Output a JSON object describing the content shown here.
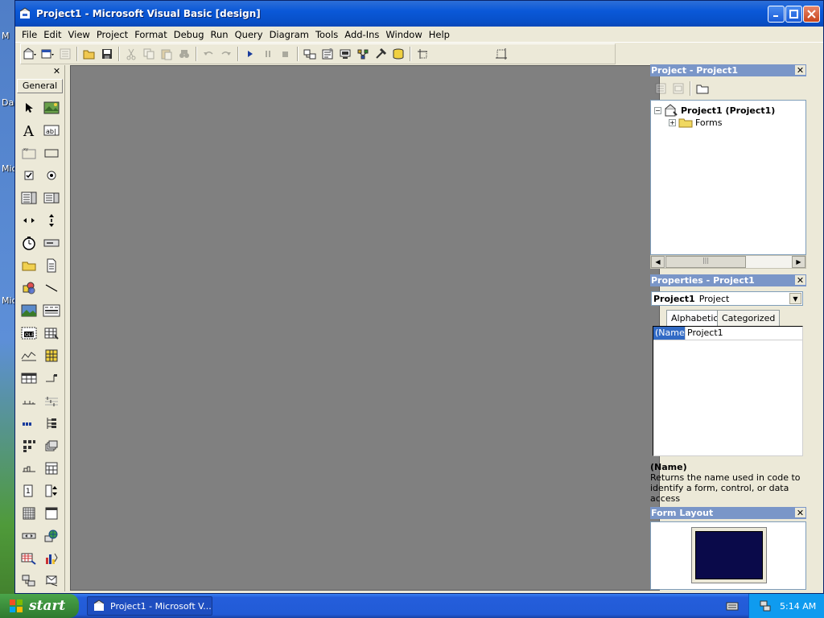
{
  "desktop": {
    "labels": [
      "M",
      "Da",
      "Mic",
      "Mic"
    ]
  },
  "window": {
    "title": "Project1 - Microsoft Visual Basic [design]"
  },
  "menu": [
    "File",
    "Edit",
    "View",
    "Project",
    "Format",
    "Debug",
    "Run",
    "Query",
    "Diagram",
    "Tools",
    "Add-Ins",
    "Window",
    "Help"
  ],
  "toolbox": {
    "tab_label": "General"
  },
  "project_pane": {
    "title": "Project - Project1",
    "tree": {
      "root": "Project1 (Project1)",
      "child": "Forms"
    }
  },
  "properties_pane": {
    "title": "Properties - Project1",
    "object_name": "Project1",
    "object_type": "Project",
    "tabs": [
      "Alphabetic",
      "Categorized"
    ],
    "rows": [
      {
        "name": "(Name)",
        "value": "Project1"
      }
    ],
    "desc_name": "(Name)",
    "desc_text": "Returns the name used in code to identify a form, control, or data access"
  },
  "form_layout": {
    "title": "Form Layout"
  },
  "taskbar": {
    "start_label": "start",
    "task_label": "Project1 - Microsoft V...",
    "clock": "5:14 AM"
  },
  "colors": {
    "titlebar": "#0a58d8",
    "mdi": "#808080",
    "pane_title": "#7a96c8",
    "selection": "#316ac5"
  }
}
